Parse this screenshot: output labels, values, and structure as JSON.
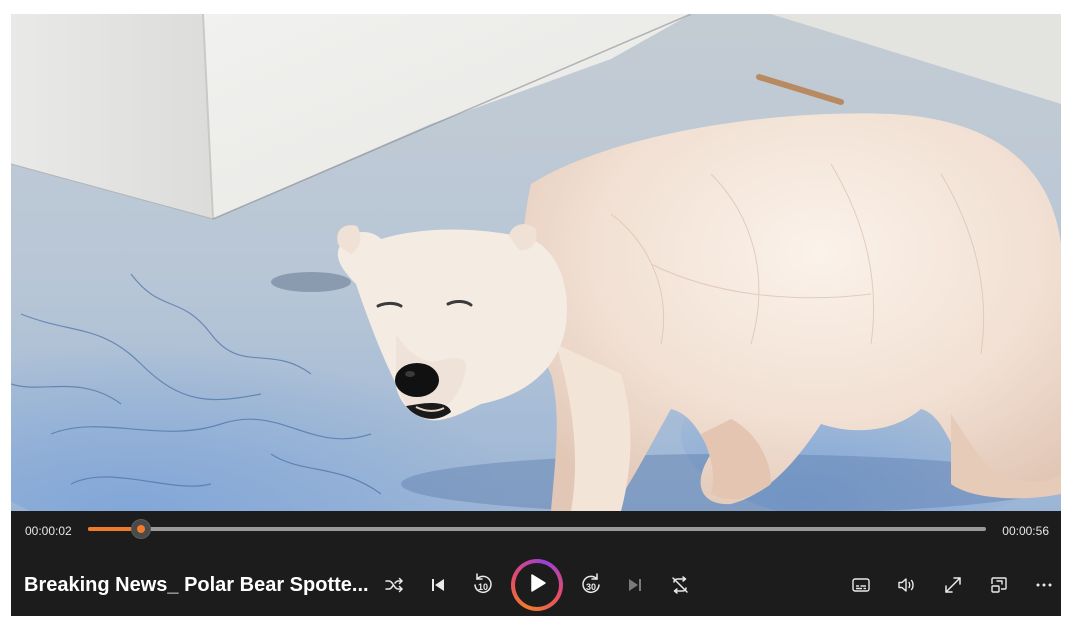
{
  "video": {
    "title": "Breaking News_ Polar Bear Spotte..."
  },
  "playback": {
    "current_time": "00:00:02",
    "duration": "00:00:56",
    "progress_fraction": 0.059,
    "state": "paused"
  },
  "controls": {
    "skip_back_seconds": "10",
    "skip_forward_seconds": "30",
    "icons": {
      "shuffle": "shuffle-icon",
      "previous": "previous-track-icon",
      "skip_back": "skip-back-10-icon",
      "play": "play-icon",
      "skip_forward": "skip-forward-30-icon",
      "next": "next-track-icon",
      "repeat": "repeat-off-icon",
      "captions": "captions-icon",
      "volume": "volume-icon",
      "fullscreen": "fullscreen-icon",
      "mini_player": "mini-player-icon",
      "more": "more-options-icon"
    }
  },
  "colors": {
    "accent": "#f07c2b",
    "bar_background": "#1c1c1c",
    "gradient_ring": [
      "#f07c2b",
      "#e24c6a",
      "#9b3fd6"
    ]
  }
}
